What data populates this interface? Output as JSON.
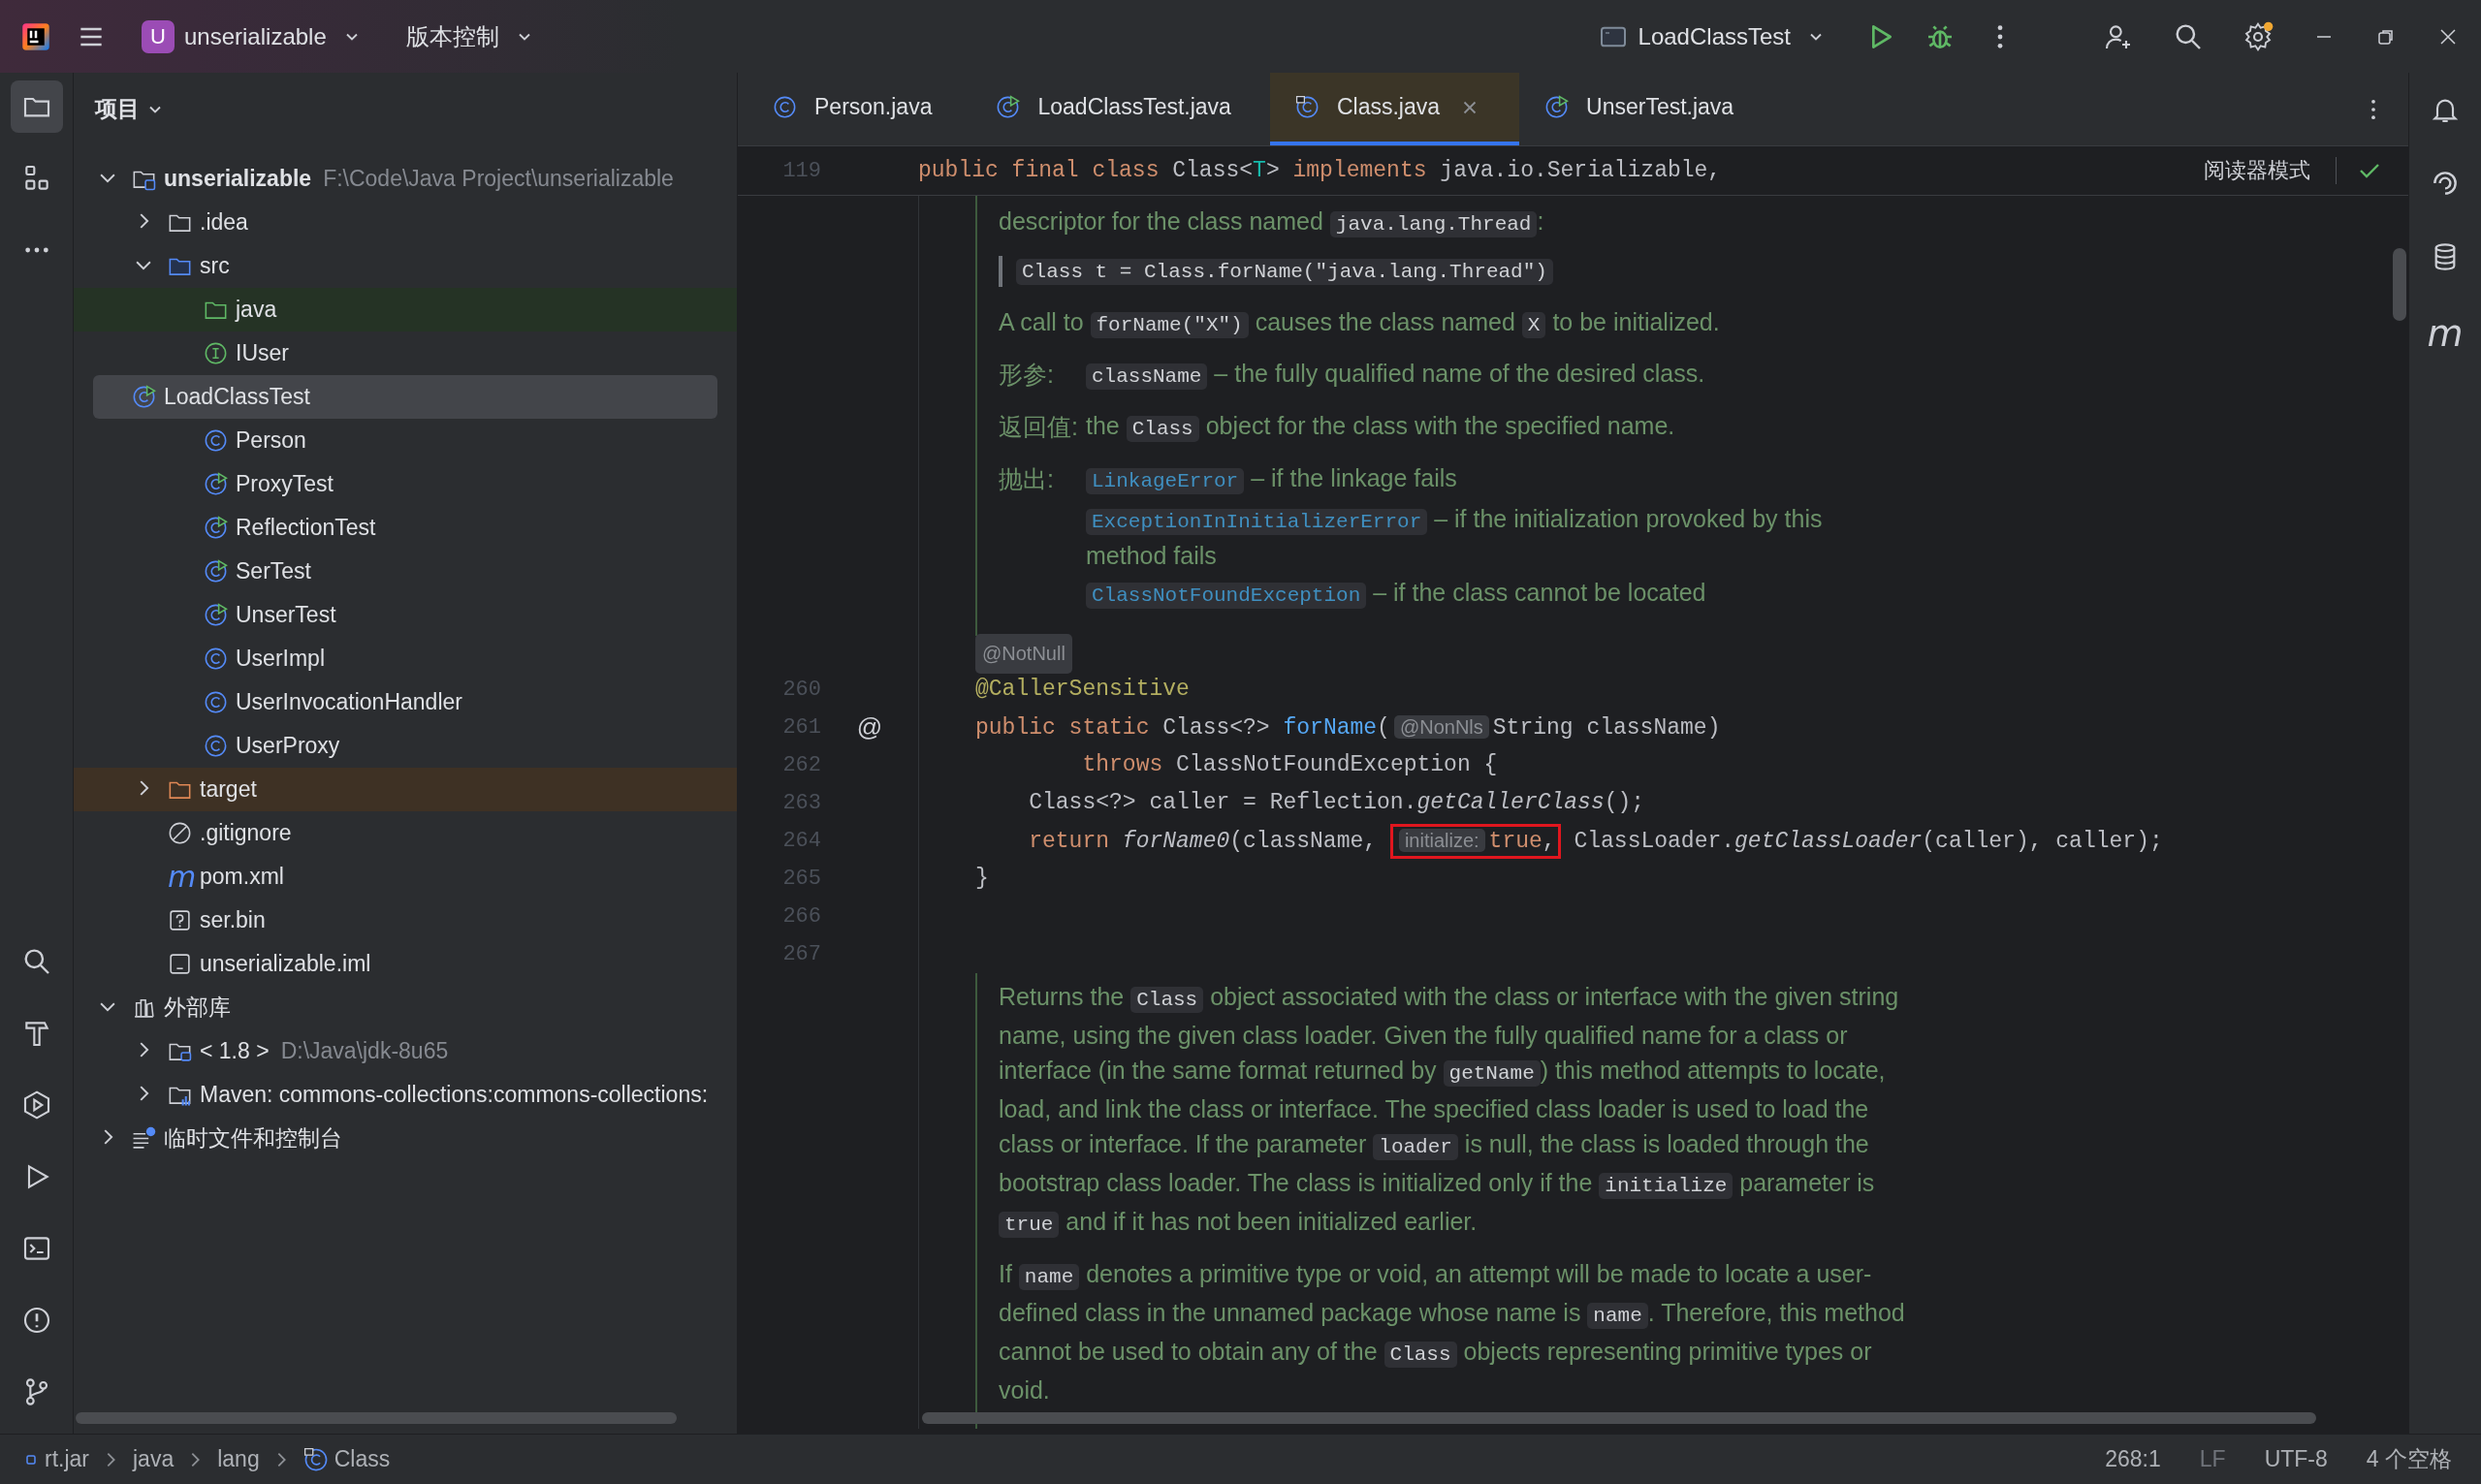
{
  "title_bar": {
    "project_badge": "U",
    "project": "unserializable",
    "vcs": "版本控制",
    "run_config": "LoadClassTest",
    "settings_badge": true
  },
  "left_stripe": {
    "top": [
      {
        "kind": "project",
        "selected": true
      },
      {
        "kind": "structure",
        "selected": false
      },
      {
        "kind": "more",
        "selected": false
      }
    ],
    "bottom": [
      {
        "kind": "search",
        "selected": false
      },
      {
        "kind": "build",
        "selected": false
      },
      {
        "kind": "services",
        "selected": false
      },
      {
        "kind": "run",
        "selected": false
      },
      {
        "kind": "terminal",
        "selected": false
      },
      {
        "kind": "problems",
        "selected": false
      },
      {
        "kind": "git",
        "selected": false
      }
    ]
  },
  "project": {
    "title": "项目",
    "tree": [
      {
        "name": "unserializable",
        "kind": "module",
        "path": "F:\\Code\\Java Project\\unserializable",
        "expanded": true,
        "selected": false,
        "children": [
          {
            "name": ".idea",
            "kind": "folder",
            "expanded": false,
            "selected": false
          },
          {
            "name": "src",
            "kind": "folder-blue",
            "expanded": true,
            "selected": false,
            "children": [
              {
                "name": "java",
                "kind": "folder-source-root",
                "selected": false
              },
              {
                "name": "IUser",
                "kind": "interface",
                "selected": false
              },
              {
                "name": "LoadClassTest",
                "kind": "class-runnable",
                "selected": true
              },
              {
                "name": "Person",
                "kind": "class",
                "selected": false
              },
              {
                "name": "ProxyTest",
                "kind": "class-runnable",
                "selected": false
              },
              {
                "name": "ReflectionTest",
                "kind": "class-runnable",
                "selected": false
              },
              {
                "name": "SerTest",
                "kind": "class-runnable",
                "selected": false
              },
              {
                "name": "UnserTest",
                "kind": "class-runnable",
                "selected": false
              },
              {
                "name": "UserImpl",
                "kind": "class",
                "selected": false
              },
              {
                "name": "UserInvocationHandler",
                "kind": "class",
                "selected": false
              },
              {
                "name": "UserProxy",
                "kind": "class",
                "selected": false
              }
            ]
          },
          {
            "name": "target",
            "kind": "folder-excluded",
            "expanded": false,
            "selected": false
          },
          {
            "name": ".gitignore",
            "kind": "gitignore",
            "selected": false
          },
          {
            "name": "pom.xml",
            "kind": "maven",
            "glyph": "m",
            "selected": false
          },
          {
            "name": "ser.bin",
            "kind": "unknown",
            "selected": false
          },
          {
            "name": "unserializable.iml",
            "kind": "iml",
            "selected": false
          }
        ]
      },
      {
        "name": "外部库",
        "kind": "libraries",
        "expanded": true,
        "selected": false,
        "children": [
          {
            "name": "< 1.8 >",
            "kind": "jdk",
            "path": "D:\\Java\\jdk-8u65",
            "expanded": false,
            "selected": false
          },
          {
            "name": "Maven: commons-collections:commons-collections:",
            "kind": "maven-lib",
            "expanded": false,
            "selected": false
          }
        ]
      },
      {
        "name": "临时文件和控制台",
        "kind": "scratches",
        "expanded": false,
        "selected": false
      }
    ]
  },
  "editor": {
    "tabs": [
      {
        "label": "Person.java",
        "kind": "class",
        "selected": false
      },
      {
        "label": "LoadClassTest.java",
        "kind": "class-runnable",
        "selected": false
      },
      {
        "label": "Class.java",
        "kind": "class-library",
        "selected": true
      },
      {
        "label": "UnserTest.java",
        "kind": "class-runnable",
        "selected": false
      }
    ],
    "sticky_line": {
      "number": "119",
      "tokens": [
        {
          "kind": "keyword",
          "text": "public final class "
        },
        {
          "kind": "plain",
          "text": "Class<"
        },
        {
          "kind": "type-param",
          "text": "T"
        },
        {
          "kind": "plain",
          "text": "> "
        },
        {
          "kind": "keyword",
          "text": "implements "
        },
        {
          "kind": "plain",
          "text": "java.io.Serializable,"
        }
      ]
    },
    "reader_mode": "阅读器模式",
    "content": [
      {
        "kind": "doc",
        "items": [
          {
            "kind": "para",
            "segments": [
              {
                "kind": "text",
                "text": "descriptor for the class named "
              },
              {
                "kind": "code",
                "text": "java.lang.Thread"
              },
              {
                "kind": "text",
                "text": ":"
              }
            ]
          },
          {
            "kind": "quote",
            "segments": [
              {
                "kind": "code",
                "text": "Class t = Class.forName(\"java.lang.Thread\")"
              }
            ]
          },
          {
            "kind": "para",
            "segments": [
              {
                "kind": "text",
                "text": "A call to "
              },
              {
                "kind": "code",
                "text": "forName(\"X\")"
              },
              {
                "kind": "text",
                "text": " causes the class named "
              },
              {
                "kind": "code",
                "text": "X"
              },
              {
                "kind": "text",
                "text": " to be initialized."
              }
            ]
          },
          {
            "kind": "tag",
            "label": "形参:",
            "entries": [
              [
                {
                  "kind": "code",
                  "text": "className"
                },
                {
                  "kind": "text",
                  "text": " – the fully qualified name of the desired class."
                }
              ]
            ]
          },
          {
            "kind": "tag",
            "label": "返回值:",
            "entries": [
              [
                {
                  "kind": "text",
                  "text": "the "
                },
                {
                  "kind": "code",
                  "text": "Class"
                },
                {
                  "kind": "text",
                  "text": " object for the class with the specified name."
                }
              ]
            ]
          },
          {
            "kind": "tag",
            "label": "抛出:",
            "entries": [
              [
                {
                  "kind": "link",
                  "text": "LinkageError"
                },
                {
                  "kind": "text",
                  "text": " – if the linkage fails"
                }
              ],
              [
                {
                  "kind": "link",
                  "text": "ExceptionInInitializerError"
                },
                {
                  "kind": "text",
                  "text": " – if the initialization provoked by this method fails"
                }
              ],
              [
                {
                  "kind": "link",
                  "text": "ClassNotFoundException"
                },
                {
                  "kind": "text",
                  "text": " – if the class cannot be located"
                }
              ]
            ]
          }
        ]
      },
      {
        "kind": "hint-line",
        "text": "@NotNull"
      },
      {
        "kind": "code",
        "number": "260",
        "tokens": [
          {
            "kind": "annotation",
            "text": "@CallerSensitive"
          }
        ]
      },
      {
        "kind": "code",
        "number": "261",
        "gutter_mark": "@",
        "tokens": [
          {
            "kind": "keyword",
            "text": "public static "
          },
          {
            "kind": "plain",
            "text": "Class<?> "
          },
          {
            "kind": "method-decl",
            "text": "forName"
          },
          {
            "kind": "plain",
            "text": "("
          },
          {
            "kind": "hint",
            "text": "@NonNls"
          },
          {
            "kind": "plain",
            "text": "String className)"
          }
        ]
      },
      {
        "kind": "code",
        "number": "262",
        "tokens": [
          {
            "kind": "keyword",
            "text": "        throws "
          },
          {
            "kind": "plain",
            "text": "ClassNotFoundException {"
          }
        ]
      },
      {
        "kind": "code",
        "number": "263",
        "tokens": [
          {
            "kind": "plain",
            "text": "    Class<?> caller = Reflection."
          },
          {
            "kind": "static-call",
            "text": "getCallerClass"
          },
          {
            "kind": "plain",
            "text": "();"
          }
        ]
      },
      {
        "kind": "code",
        "number": "264",
        "tokens": [
          {
            "kind": "keyword",
            "text": "    return "
          },
          {
            "kind": "static-call",
            "text": "forName0"
          },
          {
            "kind": "plain",
            "text": "(className, "
          },
          {
            "kind": "boxed",
            "tokens": [
              {
                "kind": "hint",
                "text": "initialize:"
              },
              {
                "kind": "keyword",
                "text": "true"
              },
              {
                "kind": "plain",
                "text": ","
              }
            ]
          },
          {
            "kind": "plain",
            "text": " ClassLoader."
          },
          {
            "kind": "static-call",
            "text": "getClassLoader"
          },
          {
            "kind": "plain",
            "text": "(caller), caller);"
          }
        ]
      },
      {
        "kind": "code",
        "number": "265",
        "tokens": [
          {
            "kind": "plain",
            "text": "}"
          }
        ]
      },
      {
        "kind": "code",
        "number": "266"
      },
      {
        "kind": "code",
        "number": "267"
      },
      {
        "kind": "doc",
        "items": [
          {
            "kind": "para",
            "segments": [
              {
                "kind": "text",
                "text": "Returns the "
              },
              {
                "kind": "code",
                "text": "Class"
              },
              {
                "kind": "text",
                "text": " object associated with the class or interface with the given string name, using the given class loader. Given the fully qualified name for a class or interface (in the same format returned by "
              },
              {
                "kind": "code",
                "text": "getName"
              },
              {
                "kind": "text",
                "text": ") this method attempts to locate, load, and link the class or interface. The specified class loader is used to load the class or interface. If the parameter "
              },
              {
                "kind": "code",
                "text": "loader"
              },
              {
                "kind": "text",
                "text": " is null, the class is loaded through the bootstrap class loader. The class is initialized only if the "
              },
              {
                "kind": "code",
                "text": "initialize"
              },
              {
                "kind": "text",
                "text": " parameter is "
              },
              {
                "kind": "code",
                "text": "true"
              },
              {
                "kind": "text",
                "text": " and if it has not been initialized earlier."
              }
            ]
          },
          {
            "kind": "para",
            "segments": [
              {
                "kind": "text",
                "text": "If "
              },
              {
                "kind": "code",
                "text": "name"
              },
              {
                "kind": "text",
                "text": " denotes a primitive type or void, an attempt will be made to locate a user-defined class in the unnamed package whose name is "
              },
              {
                "kind": "code",
                "text": "name"
              },
              {
                "kind": "text",
                "text": ". Therefore, this method cannot be used to obtain any of the "
              },
              {
                "kind": "code",
                "text": "Class"
              },
              {
                "kind": "text",
                "text": " objects representing primitive types or void."
              }
            ]
          }
        ]
      }
    ]
  },
  "right_stripe": [
    {
      "kind": "notifications"
    },
    {
      "kind": "ai"
    },
    {
      "kind": "database"
    },
    {
      "kind": "maven",
      "glyph": "m"
    }
  ],
  "status_bar": {
    "breadcrumbs": [
      {
        "label": "rt.jar",
        "kind": "jar"
      },
      {
        "label": "java",
        "kind": "package"
      },
      {
        "label": "lang",
        "kind": "package"
      },
      {
        "label": "Class",
        "kind": "class"
      }
    ],
    "items": [
      {
        "text": "268:1",
        "dim": false
      },
      {
        "text": "LF",
        "dim": true
      },
      {
        "text": "UTF-8",
        "dim": false
      },
      {
        "text": "4 个空格",
        "dim": false
      }
    ]
  }
}
